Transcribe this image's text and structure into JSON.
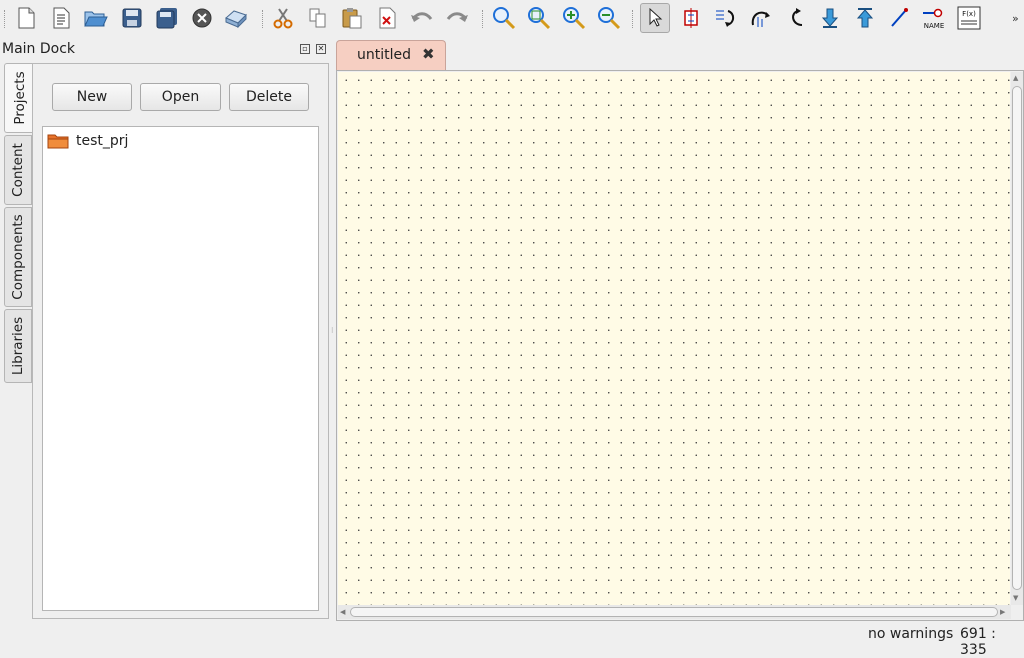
{
  "dock": {
    "title": "Main Dock",
    "tabs": [
      "Projects",
      "Content",
      "Components",
      "Libraries"
    ],
    "buttons": {
      "new": "New",
      "open": "Open",
      "delete": "Delete"
    },
    "projects": [
      "test_prj"
    ]
  },
  "document_tab": {
    "label": "untitled",
    "close": "✖"
  },
  "toolbar": {
    "icons": [
      "new-document-icon",
      "new-text-icon",
      "open-folder-icon",
      "save-icon",
      "save-all-icon",
      "close-document-icon",
      "print-icon",
      "cut-icon",
      "copy-icon",
      "paste-icon",
      "delete-icon",
      "undo-icon",
      "redo-icon",
      "zoom-fit-icon",
      "zoom-selection-icon",
      "zoom-in-icon",
      "zoom-out-icon",
      "select-pointer-icon",
      "component-edit-icon",
      "mirror-x-icon",
      "mirror-y-icon",
      "rotate-icon",
      "go-into-subcircuit-icon",
      "pop-out-icon",
      "wire-icon",
      "wire-label-icon",
      "equation-icon"
    ],
    "more": "»",
    "name_label": "NAME",
    "eq_label": "F(x)"
  },
  "status": {
    "warnings": "no warnings",
    "coords": "691 : 335"
  },
  "colors": {
    "canvas": "#fffbe6",
    "tab": "#f6cfc2",
    "accent": "#1e6fd8"
  }
}
